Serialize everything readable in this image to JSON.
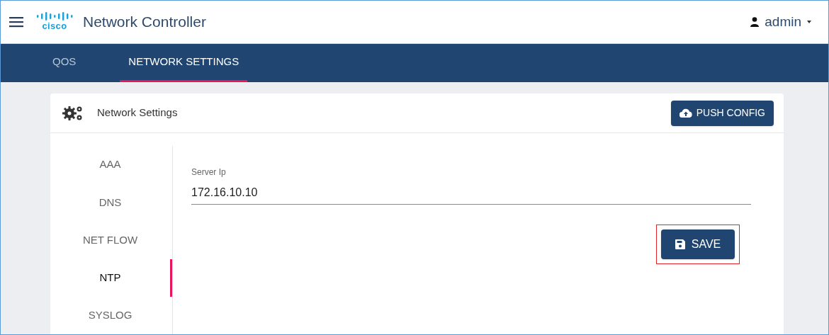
{
  "header": {
    "logo_text": "cisco",
    "title": "Network Controller",
    "user": "admin"
  },
  "tabs": [
    {
      "label": "QOS",
      "selected": false
    },
    {
      "label": "NETWORK SETTINGS",
      "selected": true
    }
  ],
  "card": {
    "title": "Network Settings",
    "push_button": "PUSH CONFIG",
    "sidebar": [
      {
        "label": "AAA",
        "selected": false
      },
      {
        "label": "DNS",
        "selected": false
      },
      {
        "label": "NET FLOW",
        "selected": false
      },
      {
        "label": "NTP",
        "selected": true
      },
      {
        "label": "SYSLOG",
        "selected": false
      }
    ],
    "field": {
      "label": "Server Ip",
      "value": "172.16.10.10"
    },
    "save_button": {
      "label": "SAVE",
      "highlighted": true
    }
  }
}
